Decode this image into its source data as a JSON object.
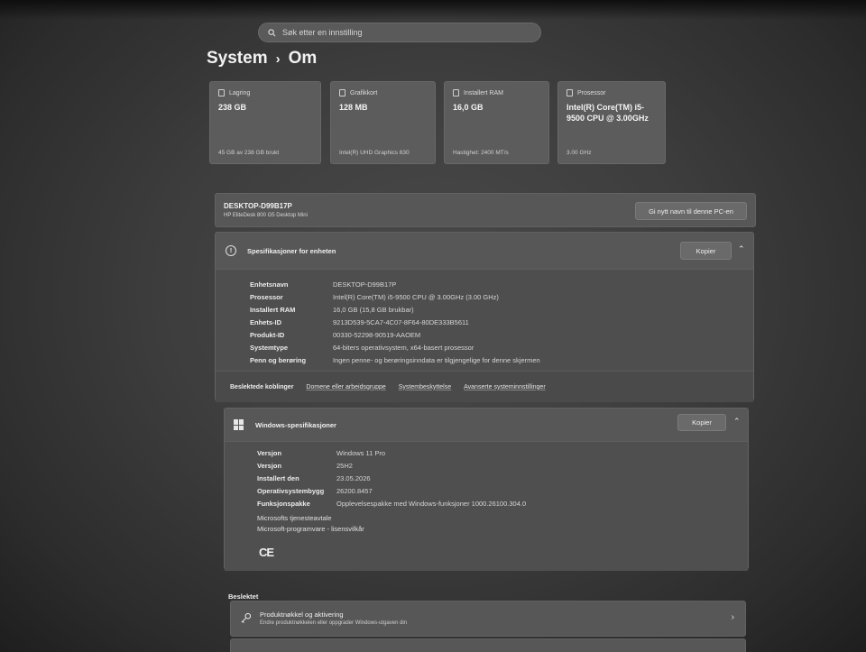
{
  "search": {
    "placeholder": "Søk etter en innstilling"
  },
  "breadcrumb": {
    "parent": "System",
    "separator": "›",
    "current": "Om"
  },
  "cards": [
    {
      "icon": "storage-icon",
      "title": "Lagring",
      "value": "238 GB",
      "sub": "45 GB av 238 GB brukt"
    },
    {
      "icon": "gpu-icon",
      "title": "Grafikkort",
      "value": "128 MB",
      "sub": "Intel(R) UHD Graphics 630"
    },
    {
      "icon": "ram-icon",
      "title": "Installert RAM",
      "value": "16,0 GB",
      "sub": "Hastighet: 2400 MT/s"
    },
    {
      "icon": "processor-icon",
      "title": "Prosessor",
      "value": "Intel(R) Core(TM) i5-9500 CPU @ 3.00GHz",
      "sub": "3.00 GHz"
    }
  ],
  "device": {
    "name": "DESKTOP-D99B17P",
    "model": "HP EliteDesk 800 G5 Desktop Mini",
    "rename_label": "Gi nytt navn til denne PC-en"
  },
  "device_specs": {
    "title": "Spesifikasjoner for enheten",
    "copy_label": "Kopier",
    "rows": [
      {
        "key": "Enhetsnavn",
        "value": "DESKTOP-D99B17P"
      },
      {
        "key": "Prosessor",
        "value": "Intel(R) Core(TM) i5-9500 CPU @ 3.00GHz (3.00 GHz)"
      },
      {
        "key": "Installert RAM",
        "value": "16,0 GB (15,8 GB brukbar)"
      },
      {
        "key": "Enhets-ID",
        "value": "9213D539-5CA7-4C07-8F64-80DE333B5611"
      },
      {
        "key": "Produkt-ID",
        "value": "00330-52298-90519-AAOEM"
      },
      {
        "key": "Systemtype",
        "value": "64-biters operativsystem, x64-basert prosessor"
      },
      {
        "key": "Penn og berøring",
        "value": "Ingen penne- og berøringsinndata er tilgjengelige for denne skjermen"
      }
    ]
  },
  "related_links": {
    "label": "Beslektede koblinger",
    "items": [
      "Domene eller arbeidsgruppe",
      "Systembeskyttelse",
      "Avanserte systeminnstillinger"
    ]
  },
  "windows_specs": {
    "title": "Windows-spesifikasjoner",
    "copy_label": "Kopier",
    "rows": [
      {
        "key": "Versjon",
        "value": "Windows 11 Pro"
      },
      {
        "key": "Versjon",
        "value": "25H2"
      },
      {
        "key": "Installert den",
        "value": "23.05.2026"
      },
      {
        "key": "Operativsystembygg",
        "value": "26200.8457"
      },
      {
        "key": "Funksjonspakke",
        "value": "Opplevelsespakke med Windows-funksjoner 1000.26100.304.0"
      }
    ],
    "links": [
      "Microsofts tjenesteavtale",
      "Microsoft-programvare - lisensvilkår"
    ],
    "ce_mark": "CE"
  },
  "related": {
    "title": "Beslektet",
    "items": [
      {
        "title": "Produktnøkkel og aktivering",
        "sub": "Endre produktnøkkelen eller oppgrader Windows-utgaven din"
      }
    ]
  }
}
